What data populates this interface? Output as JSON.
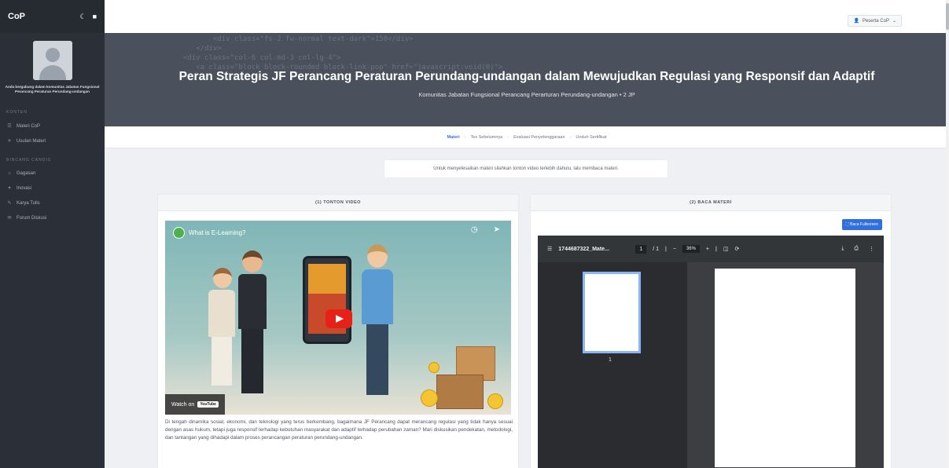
{
  "app": {
    "brand": "CoP"
  },
  "sidebar": {
    "profile_text": "Anda bergabung dalam komunitas Jabatan Fungsional Perancang Peraturan Perundang-undangan",
    "sections": [
      {
        "title": "KONTEN",
        "items": [
          {
            "label": "Materi CoP",
            "icon": "book-icon"
          },
          {
            "label": "Usulan Materi",
            "icon": "lightbulb-icon"
          }
        ]
      },
      {
        "title": "BINCANG CANDIS",
        "items": [
          {
            "label": "Gagasan",
            "icon": "idea-icon"
          },
          {
            "label": "Inovasi",
            "icon": "star-icon"
          },
          {
            "label": "Karya Tulis",
            "icon": "pen-icon"
          },
          {
            "label": "Forum Diskusi",
            "icon": "chat-icon"
          }
        ]
      }
    ]
  },
  "topbar": {
    "user_label": "Peserta CoP"
  },
  "hero": {
    "title": "Peran Strategis JF Perancang Peraturan Perundang-undangan dalam Mewujudkan Regulasi yang Responsif dan Adaptif",
    "subtitle": "Komunitas Jabatan Fungsional Perancang Perarturan Perundang-undangan • 2 JP",
    "code_lines": [
      "       <div class=\"fs-2 fw-normal text-dark\">150</div>",
      "   </div>",
      "",
      "",
      "",
      "",
      "",
      "",
      "<div class=\"col-6 col-md-3 col-lg-4\">",
      "   <a class=\"block block-rounded block-link-pop\" href=\"javascript:void(0)\">"
    ]
  },
  "breadcrumb": {
    "steps": [
      "Materi",
      "Tes Sebelumnya",
      "Evaluasi Penyelenggaraan",
      "Unduh Sertifikat"
    ]
  },
  "notice": "Untuk menyelesaikan materi silahkan tonton video terlebih dahulu, lalu membaca materi.",
  "video_card": {
    "header": "(1) TONTON VIDEO",
    "video_title": "What is E-Learning?",
    "watch_label": "Watch on",
    "youtube_label": "YouTube",
    "description": "Di tengah dinamika sosial, ekonomi, dan teknologi yang terus berkembang, bagaimana JF Perancang dapat merancang regulasi yang tidak hanya sesuai dengan asas hukum, tetapi juga responsif terhadap kebutuhan masyarakat dan adaptif terhadap perubahan zaman? Mari diskusikan pendekatan, metodologi, dan tantangan yang dihadapi dalam proses perancangan peraturan perundang-undangan."
  },
  "pdf_card": {
    "header": "(2) BACA MATERI",
    "fullscreen_label": "Baca Fullscreen",
    "file_name": "1744687322_Mate...",
    "page_current": "1",
    "page_total": "/ 1",
    "zoom": "36%",
    "thumb_number": "1"
  }
}
